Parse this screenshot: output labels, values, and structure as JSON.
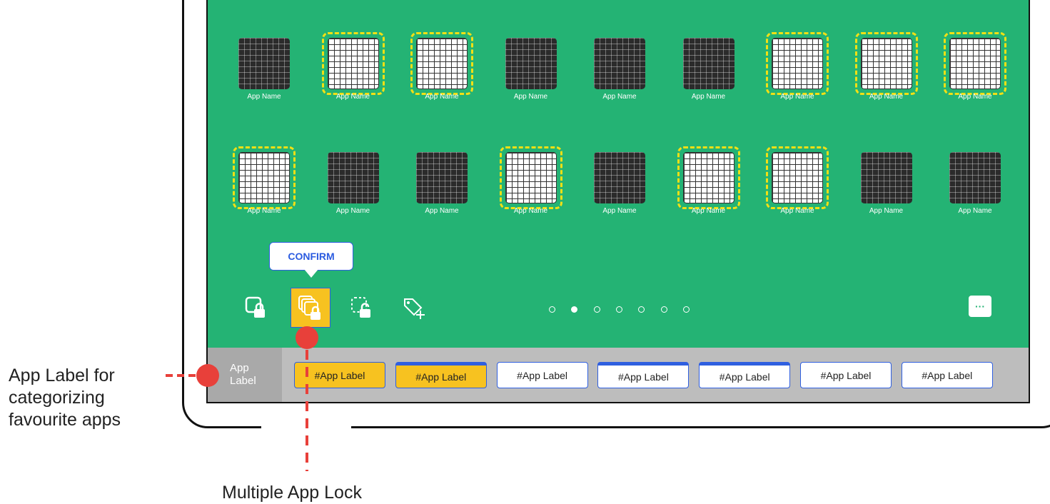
{
  "apps": {
    "row1": [
      {
        "name": "App Name",
        "selected": false
      },
      {
        "name": "App Name",
        "selected": true
      },
      {
        "name": "App Name",
        "selected": true
      },
      {
        "name": "App Name",
        "selected": false
      },
      {
        "name": "App Name",
        "selected": false
      },
      {
        "name": "App Name",
        "selected": false
      },
      {
        "name": "App Name",
        "selected": true
      },
      {
        "name": "App Name",
        "selected": true
      },
      {
        "name": "App Name",
        "selected": true
      }
    ],
    "row2": [
      {
        "name": "App Name",
        "selected": true
      },
      {
        "name": "App Name",
        "selected": false
      },
      {
        "name": "App Name",
        "selected": false
      },
      {
        "name": "App Name",
        "selected": true
      },
      {
        "name": "App Name",
        "selected": false
      },
      {
        "name": "App Name",
        "selected": true
      },
      {
        "name": "App Name",
        "selected": true
      },
      {
        "name": "App Name",
        "selected": false
      },
      {
        "name": "App Name",
        "selected": false
      }
    ]
  },
  "toolbar": {
    "confirm_label": "CONFIRM",
    "icons": [
      "single-app-lock-icon",
      "multiple-app-lock-icon",
      "unlock-icon",
      "add-tag-icon",
      "chat-icon"
    ],
    "chat_glyph": "···"
  },
  "pager": {
    "pages": 7,
    "active_index": 1
  },
  "label_bar": {
    "title_line1": "App",
    "title_line2": "Label",
    "chips": [
      "#App Label",
      "#App Label",
      "#App Label",
      "#App Label",
      "#App Label",
      "#App Label",
      "#App Label"
    ]
  },
  "annotations": {
    "app_label_line1": "App Label for",
    "app_label_line2": "categorizing",
    "app_label_line3": "favourite apps",
    "multi_lock": "Multiple App Lock"
  },
  "colors": {
    "screen": "#24b374",
    "accent_yellow": "#f7c220",
    "accent_blue": "#2f5fe0",
    "marker_red": "#e8403a",
    "selection_dash": "#f2e014"
  }
}
